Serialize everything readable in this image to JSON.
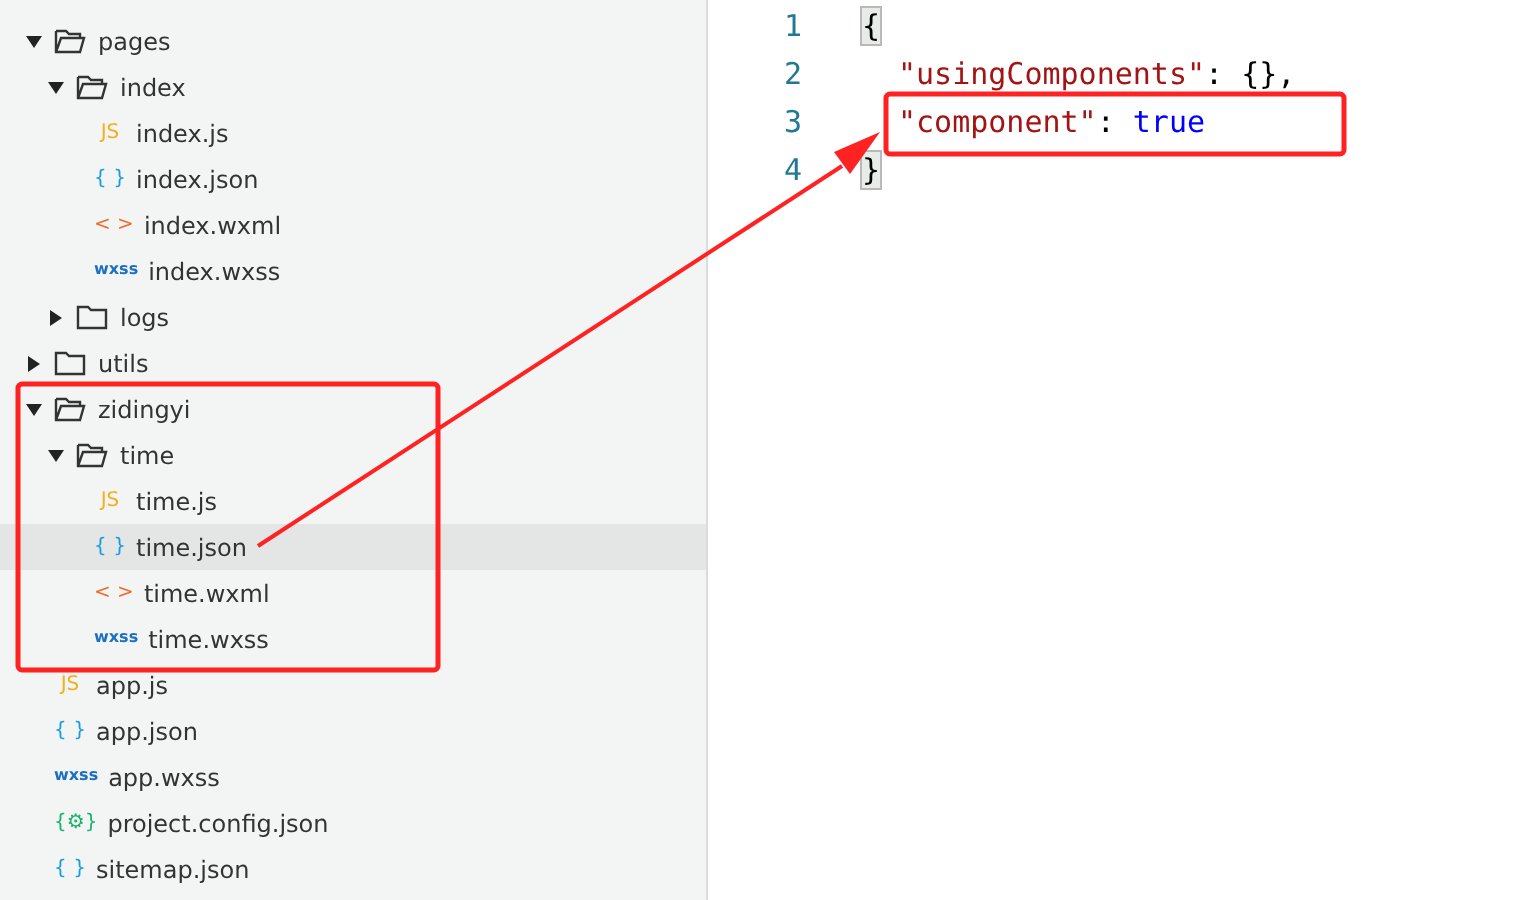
{
  "explorer": {
    "tree": [
      {
        "name": "pages",
        "kind": "folder",
        "expanded": true,
        "selected": false,
        "children": [
          {
            "name": "index",
            "kind": "folder",
            "expanded": true,
            "selected": false,
            "children": [
              {
                "name": "index.js",
                "kind": "script",
                "glyph": "JS",
                "selected": false
              },
              {
                "name": "index.json",
                "kind": "data",
                "glyph": "{ }",
                "selected": false
              },
              {
                "name": "index.wxml",
                "kind": "markup",
                "glyph": "< >",
                "selected": false
              },
              {
                "name": "index.wxss",
                "kind": "style",
                "glyph": "wxss",
                "selected": false
              }
            ]
          },
          {
            "name": "logs",
            "kind": "folder",
            "expanded": false,
            "selected": false
          }
        ]
      },
      {
        "name": "utils",
        "kind": "folder",
        "expanded": false,
        "selected": false
      },
      {
        "name": "zidingyi",
        "kind": "folder",
        "expanded": true,
        "selected": false,
        "children": [
          {
            "name": "time",
            "kind": "folder",
            "expanded": true,
            "selected": false,
            "children": [
              {
                "name": "time.js",
                "kind": "script",
                "glyph": "JS",
                "selected": false
              },
              {
                "name": "time.json",
                "kind": "data",
                "glyph": "{ }",
                "selected": true
              },
              {
                "name": "time.wxml",
                "kind": "markup",
                "glyph": "< >",
                "selected": false
              },
              {
                "name": "time.wxss",
                "kind": "style",
                "glyph": "wxss",
                "selected": false
              }
            ]
          }
        ]
      },
      {
        "name": "app.js",
        "kind": "script",
        "glyph": "JS",
        "selected": false
      },
      {
        "name": "app.json",
        "kind": "data",
        "glyph": "{ }",
        "selected": false
      },
      {
        "name": "app.wxss",
        "kind": "style",
        "glyph": "wxss",
        "selected": false
      },
      {
        "name": "project.config.json",
        "kind": "config",
        "glyph": "{⚙}",
        "selected": false
      },
      {
        "name": "sitemap.json",
        "kind": "data",
        "glyph": "{ }",
        "selected": false
      }
    ]
  },
  "editor": {
    "lines": [
      {
        "number": "1",
        "tokens": [
          {
            "kind": "bracket",
            "text": "{",
            "matched": true
          }
        ]
      },
      {
        "number": "2",
        "indented": true,
        "tokens": [
          {
            "kind": "key",
            "text": "\"usingComponents\""
          },
          {
            "kind": "punct",
            "text": ": {},"
          }
        ]
      },
      {
        "number": "3",
        "indented": true,
        "tokens": [
          {
            "kind": "key",
            "text": "\"component\""
          },
          {
            "kind": "punct",
            "text": ": "
          },
          {
            "kind": "literal",
            "text": "true"
          }
        ]
      },
      {
        "number": "4",
        "tokens": [
          {
            "kind": "bracket",
            "text": "}",
            "matched": true
          }
        ]
      }
    ]
  }
}
